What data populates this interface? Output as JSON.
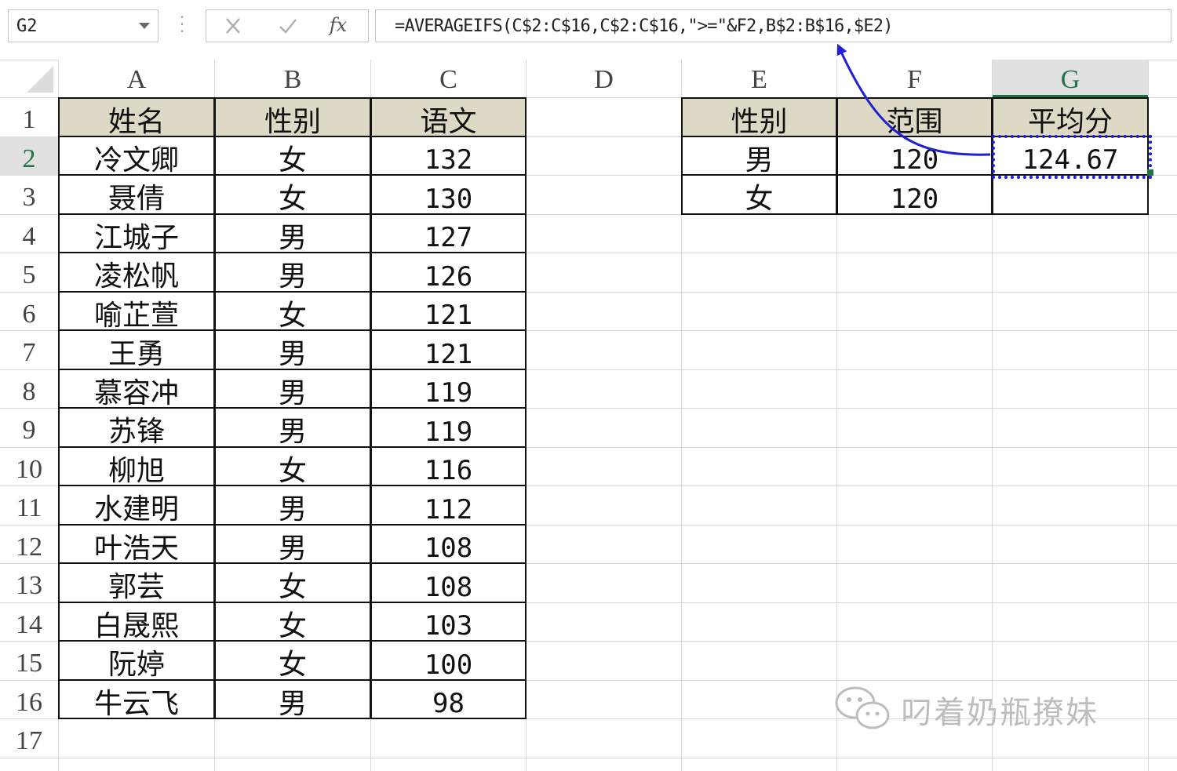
{
  "formula_bar": {
    "name_box": "G2",
    "formula": "=AVERAGEIFS(C$2:C$16,C$2:C$16,\">=\"&F2,B$2:B$16,$E2)",
    "icons": [
      "cancel-x-icon",
      "confirm-check-icon",
      "fx-icon"
    ],
    "fx_label": "fx"
  },
  "columns": [
    "A",
    "B",
    "C",
    "D",
    "E",
    "F",
    "G"
  ],
  "rows": [
    "1",
    "2",
    "3",
    "4",
    "5",
    "6",
    "7",
    "8",
    "9",
    "10",
    "11",
    "12",
    "13",
    "14",
    "15",
    "16",
    "17"
  ],
  "table_main": {
    "headers": [
      "姓名",
      "性别",
      "语文"
    ],
    "rows": [
      [
        "冷文卿",
        "女",
        "132"
      ],
      [
        "聂倩",
        "女",
        "130"
      ],
      [
        "江城子",
        "男",
        "127"
      ],
      [
        "凌松帆",
        "男",
        "126"
      ],
      [
        "喻芷萱",
        "女",
        "121"
      ],
      [
        "王勇",
        "男",
        "121"
      ],
      [
        "慕容冲",
        "男",
        "119"
      ],
      [
        "苏锋",
        "男",
        "119"
      ],
      [
        "柳旭",
        "女",
        "116"
      ],
      [
        "水建明",
        "男",
        "112"
      ],
      [
        "叶浩天",
        "男",
        "108"
      ],
      [
        "郭芸",
        "女",
        "108"
      ],
      [
        "白晟熙",
        "女",
        "103"
      ],
      [
        "阮婷",
        "女",
        "100"
      ],
      [
        "牛云飞",
        "男",
        "98"
      ]
    ]
  },
  "table_summary": {
    "headers": [
      "性别",
      "范围",
      "平均分"
    ],
    "rows": [
      [
        "男",
        "120",
        "124.67"
      ],
      [
        "女",
        "120",
        ""
      ]
    ]
  },
  "selected_cell": "G2",
  "colors": {
    "header_fill": "#ddd9c4",
    "selection_border": "#1f1fd6",
    "active_header": "#217346"
  },
  "watermark": "叼着奶瓶撩妹"
}
